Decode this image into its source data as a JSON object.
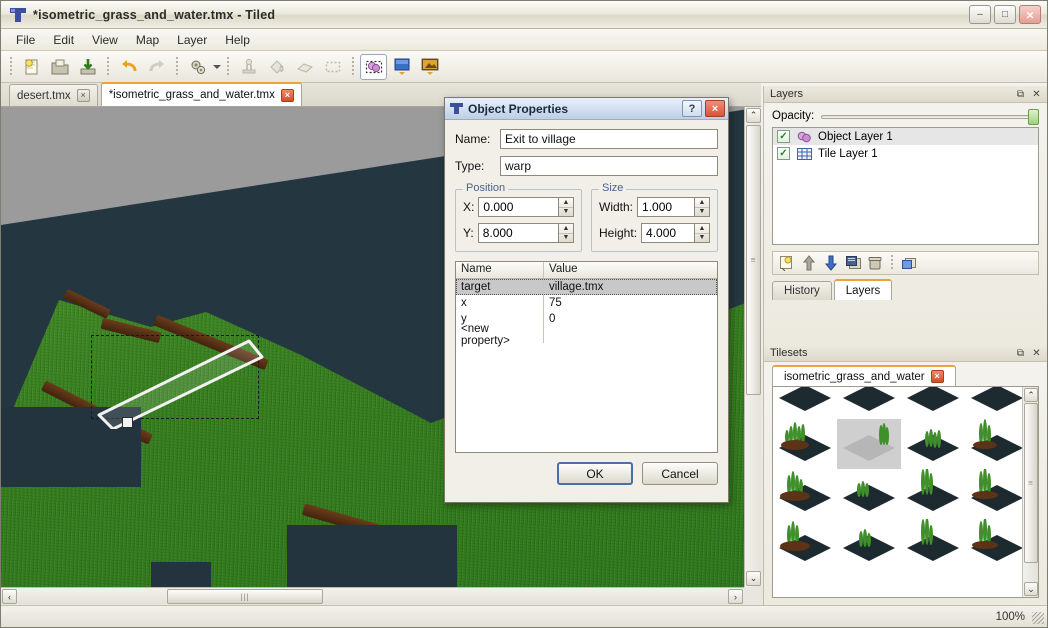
{
  "window": {
    "title": "*isometric_grass_and_water.tmx - Tiled",
    "app_icon": "tiled-logo-icon",
    "controls": {
      "minimize": "–",
      "maximize": "□",
      "close": "×"
    }
  },
  "menubar": {
    "items": [
      "File",
      "Edit",
      "View",
      "Map",
      "Layer",
      "Help"
    ]
  },
  "toolbar": {
    "groups": [
      {
        "buttons": [
          {
            "name": "new-map-button",
            "icon": "new-document-icon"
          },
          {
            "name": "open-map-button",
            "icon": "open-folder-icon"
          },
          {
            "name": "save-map-button",
            "icon": "save-disk-icon"
          }
        ]
      },
      {
        "buttons": [
          {
            "name": "undo-button",
            "icon": "undo-arrow-icon"
          },
          {
            "name": "redo-button",
            "icon": "redo-arrow-icon",
            "disabled": true
          }
        ]
      },
      {
        "buttons": [
          {
            "name": "map-properties-button",
            "icon": "gears-icon",
            "has_dropdown": true
          }
        ]
      },
      {
        "buttons": [
          {
            "name": "stamp-brush-tool",
            "icon": "stamp-icon",
            "disabled": true
          },
          {
            "name": "fill-bucket-tool",
            "icon": "paint-bucket-icon",
            "disabled": true
          },
          {
            "name": "eraser-tool",
            "icon": "eraser-icon",
            "disabled": true
          },
          {
            "name": "select-rectangle-tool",
            "icon": "marquee-select-icon",
            "disabled": true
          }
        ]
      },
      {
        "buttons": [
          {
            "name": "select-objects-tool",
            "icon": "object-select-icon",
            "active": true
          },
          {
            "name": "add-tile-layer-button",
            "icon": "tile-layer-icon"
          },
          {
            "name": "add-image-layer-button",
            "icon": "image-layer-icon"
          }
        ]
      }
    ]
  },
  "document_tabs": [
    {
      "label": "desert.tmx",
      "active": false,
      "close": "×"
    },
    {
      "label": "*isometric_grass_and_water.tmx",
      "active": true,
      "close": "×"
    }
  ],
  "canvas": {
    "object": {
      "name_hint": "selected-map-object",
      "handle": "resize-handle"
    },
    "scroll": {
      "left_arrow": "‹",
      "right_arrow": "›",
      "up_arrow": "⌃",
      "down_arrow": "⌄"
    }
  },
  "layers_dock": {
    "title": "Layers",
    "float_icon": "undock-icon",
    "close_icon": "close-icon",
    "opacity_label": "Opacity:",
    "opacity_value": 100,
    "items": [
      {
        "label": "Object Layer 1",
        "checked": true,
        "icon": "object-layer-icon",
        "selected": true
      },
      {
        "label": "Tile Layer 1",
        "checked": true,
        "icon": "tile-layer-grid-icon",
        "selected": false
      }
    ],
    "toolbar": [
      {
        "name": "new-layer-button",
        "icon": "new-layer-icon"
      },
      {
        "name": "raise-layer-button",
        "icon": "arrow-up-icon"
      },
      {
        "name": "lower-layer-button",
        "icon": "arrow-down-icon"
      },
      {
        "name": "duplicate-layer-button",
        "icon": "duplicate-icon"
      },
      {
        "name": "delete-layer-button",
        "icon": "trash-icon"
      },
      {
        "name": "layer-properties-button",
        "icon": "properties-icon"
      }
    ],
    "tabs": [
      {
        "label": "History",
        "active": false
      },
      {
        "label": "Layers",
        "active": true
      }
    ]
  },
  "tilesets_dock": {
    "title": "Tilesets",
    "float_icon": "undock-icon",
    "close_icon": "close-icon",
    "tabs": [
      {
        "label": "isometric_grass_and_water",
        "active": true,
        "close": "×"
      }
    ],
    "tiles": [
      [
        {
          "id": 0,
          "kind": "grass-tuft",
          "selected": false
        },
        {
          "id": 1,
          "kind": "empty-water",
          "selected": false
        },
        {
          "id": 2,
          "kind": "grass-edge",
          "selected": false
        },
        {
          "id": 3,
          "kind": "grass-tall",
          "selected": false
        }
      ],
      [
        {
          "id": 4,
          "kind": "grass-tuft",
          "selected": true
        },
        {
          "id": 5,
          "kind": "empty-tile",
          "selected": false
        },
        {
          "id": 6,
          "kind": "grass-edge",
          "selected": false
        },
        {
          "id": 7,
          "kind": "grass-corner",
          "selected": false
        }
      ],
      [
        {
          "id": 8,
          "kind": "grass-corner",
          "selected": false
        },
        {
          "id": 9,
          "kind": "grass-low",
          "selected": false
        },
        {
          "id": 10,
          "kind": "grass-tall",
          "selected": false
        },
        {
          "id": 11,
          "kind": "grass-corner",
          "selected": false
        }
      ],
      [
        {
          "id": 12,
          "kind": "grass-corner",
          "selected": false
        },
        {
          "id": 13,
          "kind": "grass-low",
          "selected": false
        },
        {
          "id": 14,
          "kind": "grass-tall",
          "selected": false
        },
        {
          "id": 15,
          "kind": "grass-corner",
          "selected": false
        }
      ]
    ],
    "scroll": {
      "up_arrow": "⌃",
      "down_arrow": "⌄"
    }
  },
  "dialog": {
    "title": "Object Properties",
    "icon": "tiled-logo-icon",
    "help_label": "?",
    "close_label": "×",
    "name_label": "Name:",
    "name_value": "Exit to village",
    "type_label": "Type:",
    "type_value": "warp",
    "position": {
      "legend": "Position",
      "x_label": "X:",
      "x_value": "0.000",
      "y_label": "Y:",
      "y_value": "8.000"
    },
    "size": {
      "legend": "Size",
      "width_label": "Width:",
      "width_value": "1.000",
      "height_label": "Height:",
      "height_value": "4.000"
    },
    "properties_table": {
      "headers": [
        "Name",
        "Value"
      ],
      "rows": [
        {
          "name": "target",
          "value": "village.tmx",
          "selected": true
        },
        {
          "name": "x",
          "value": "75",
          "selected": false
        },
        {
          "name": "y",
          "value": "0",
          "selected": false
        },
        {
          "name": "<new property>",
          "value": "",
          "selected": false
        }
      ]
    },
    "ok_label": "OK",
    "cancel_label": "Cancel",
    "spinner_up": "▲",
    "spinner_down": "▼"
  },
  "statusbar": {
    "zoom": "100%"
  },
  "colors": {
    "accent_orange": "#e8a33d",
    "grass": "#3f8f2a",
    "water": "#243640",
    "dirt": "#5c3316",
    "canvas_bg": "#9b9b9b",
    "dialog_title": "#cfdcee",
    "selection_white": "#f0f0f0"
  }
}
